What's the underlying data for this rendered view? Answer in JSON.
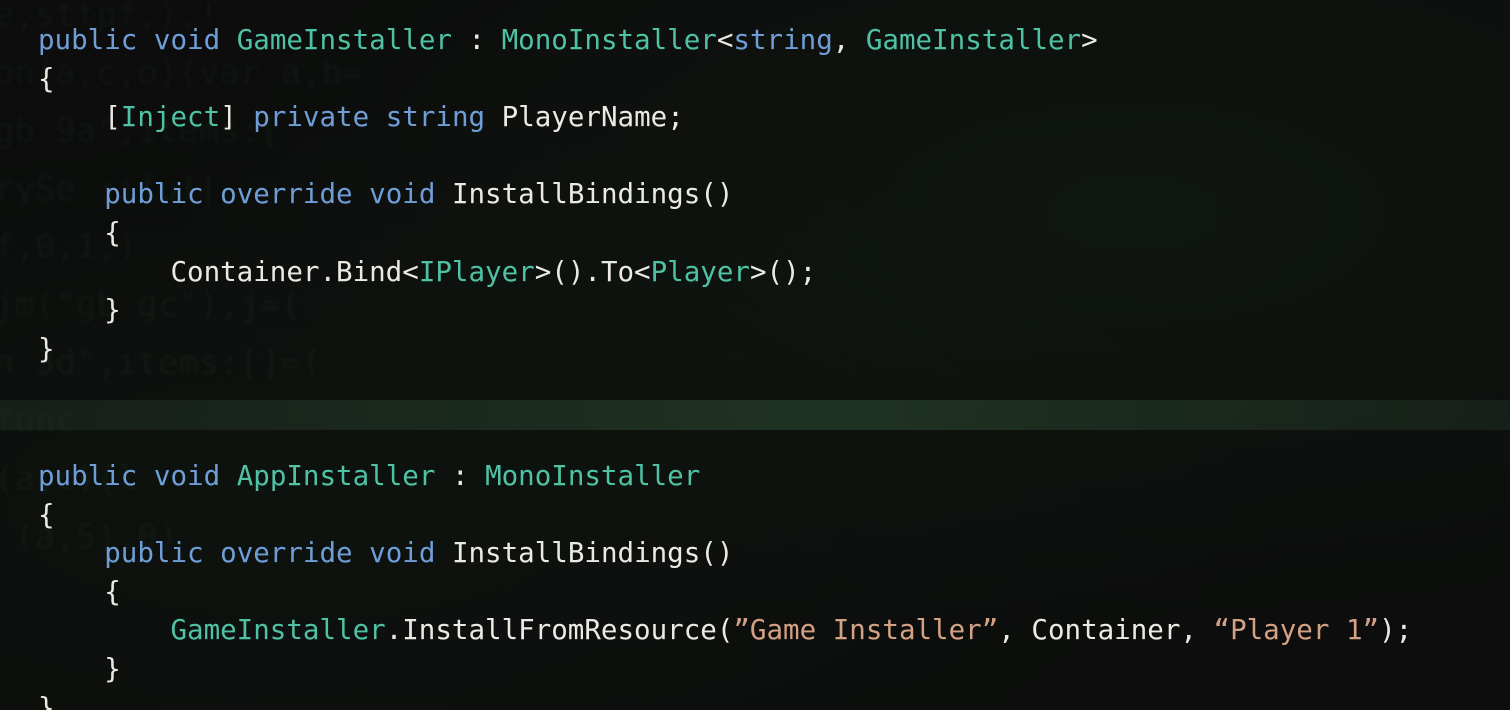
{
  "colors": {
    "background": "#0c0d0c",
    "keyword": "#6f9ed6",
    "type": "#4fc1a5",
    "plain": "#ece9e2",
    "string": "#d3a184"
  },
  "background_code": [
    "e,sttpf,),!",
    "on(a,c,o){var a,b=",
    "gb_9a\",items:[",
    "rySe ;ifu!|",
    "f,0,1,)",
    "jm(\"gb_gc\"),j=(",
    "n 3d\",items:[]=(",
    "",
    "func",
    "(a,c){l",
    " (a,5),0)"
  ],
  "code": {
    "block1": [
      [
        {
          "t": "public",
          "c": "kw"
        },
        {
          "t": " ",
          "c": "pl"
        },
        {
          "t": "void",
          "c": "kw"
        },
        {
          "t": " ",
          "c": "pl"
        },
        {
          "t": "GameInstaller",
          "c": "ty"
        },
        {
          "t": " : ",
          "c": "pl"
        },
        {
          "t": "MonoInstaller",
          "c": "ty"
        },
        {
          "t": "<",
          "c": "pl"
        },
        {
          "t": "string",
          "c": "kw"
        },
        {
          "t": ", ",
          "c": "pl"
        },
        {
          "t": "GameInstaller",
          "c": "ty"
        },
        {
          "t": ">",
          "c": "pl"
        }
      ],
      [
        {
          "t": "{",
          "c": "pl"
        }
      ],
      [
        {
          "t": "    [",
          "c": "pl"
        },
        {
          "t": "Inject",
          "c": "ty"
        },
        {
          "t": "] ",
          "c": "pl"
        },
        {
          "t": "private",
          "c": "kw"
        },
        {
          "t": " ",
          "c": "pl"
        },
        {
          "t": "string",
          "c": "kw"
        },
        {
          "t": " PlayerName;",
          "c": "pl"
        }
      ],
      [],
      [
        {
          "t": "    ",
          "c": "pl"
        },
        {
          "t": "public",
          "c": "kw"
        },
        {
          "t": " ",
          "c": "pl"
        },
        {
          "t": "override",
          "c": "kw"
        },
        {
          "t": " ",
          "c": "pl"
        },
        {
          "t": "void",
          "c": "kw"
        },
        {
          "t": " InstallBindings()",
          "c": "pl"
        }
      ],
      [
        {
          "t": "    {",
          "c": "pl"
        }
      ],
      [
        {
          "t": "        Container.Bind<",
          "c": "pl"
        },
        {
          "t": "IPlayer",
          "c": "ty"
        },
        {
          "t": ">().To<",
          "c": "pl"
        },
        {
          "t": "Player",
          "c": "ty"
        },
        {
          "t": ">();",
          "c": "pl"
        }
      ],
      [
        {
          "t": "    }",
          "c": "pl"
        }
      ],
      [
        {
          "t": "}",
          "c": "pl"
        }
      ]
    ],
    "block2": [
      [
        {
          "t": "public",
          "c": "kw"
        },
        {
          "t": " ",
          "c": "pl"
        },
        {
          "t": "void",
          "c": "kw"
        },
        {
          "t": " ",
          "c": "pl"
        },
        {
          "t": "AppInstaller",
          "c": "ty"
        },
        {
          "t": " : ",
          "c": "pl"
        },
        {
          "t": "MonoInstaller",
          "c": "ty"
        }
      ],
      [
        {
          "t": "{",
          "c": "pl"
        }
      ],
      [
        {
          "t": "    ",
          "c": "pl"
        },
        {
          "t": "public",
          "c": "kw"
        },
        {
          "t": " ",
          "c": "pl"
        },
        {
          "t": "override",
          "c": "kw"
        },
        {
          "t": " ",
          "c": "pl"
        },
        {
          "t": "void",
          "c": "kw"
        },
        {
          "t": " InstallBindings()",
          "c": "pl"
        }
      ],
      [
        {
          "t": "    {",
          "c": "pl"
        }
      ],
      [
        {
          "t": "        ",
          "c": "pl"
        },
        {
          "t": "GameInstaller",
          "c": "ty"
        },
        {
          "t": ".InstallFromResource(",
          "c": "pl"
        },
        {
          "t": "”Game Installer”",
          "c": "st"
        },
        {
          "t": ", Container, ",
          "c": "pl"
        },
        {
          "t": "“Player 1”",
          "c": "st"
        },
        {
          "t": ");",
          "c": "pl"
        }
      ],
      [
        {
          "t": "    }",
          "c": "pl"
        }
      ],
      [
        {
          "t": "}",
          "c": "pl"
        }
      ]
    ]
  }
}
